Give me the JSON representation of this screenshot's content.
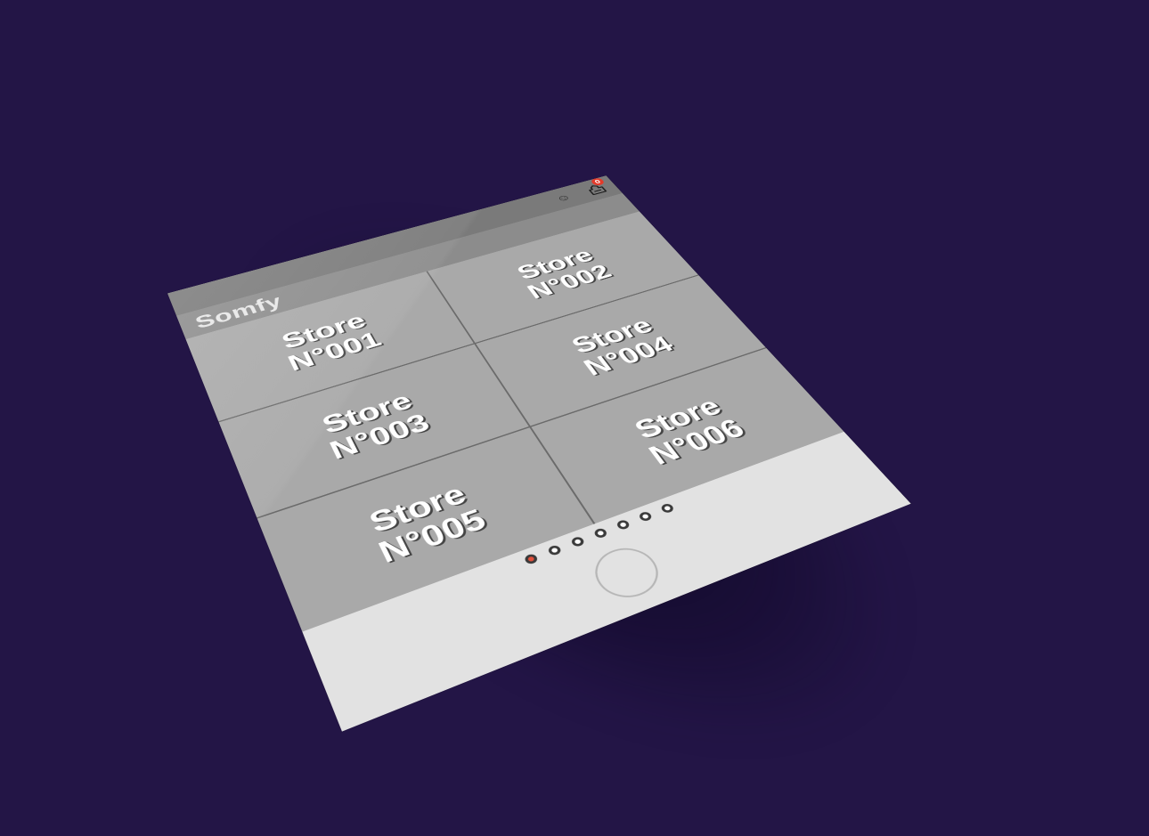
{
  "app": {
    "title": "Somfy"
  },
  "topbar": {
    "user_icon": "user-face-icon",
    "cart_icon": "cart-icon",
    "cart_badge": "0"
  },
  "tiles": [
    {
      "label": "Store\nN°001"
    },
    {
      "label": "Store\nN°002"
    },
    {
      "label": "Store\nN°003"
    },
    {
      "label": "Store\nN°004"
    },
    {
      "label": "Store\nN°005"
    },
    {
      "label": "Store\nN°006"
    }
  ],
  "pagination": {
    "total_pages": 7,
    "active_page": 1
  },
  "colors": {
    "background": "#231546",
    "tile": "#a9a9a9",
    "active_dot": "#e2503b",
    "badge": "#e23b2b"
  }
}
